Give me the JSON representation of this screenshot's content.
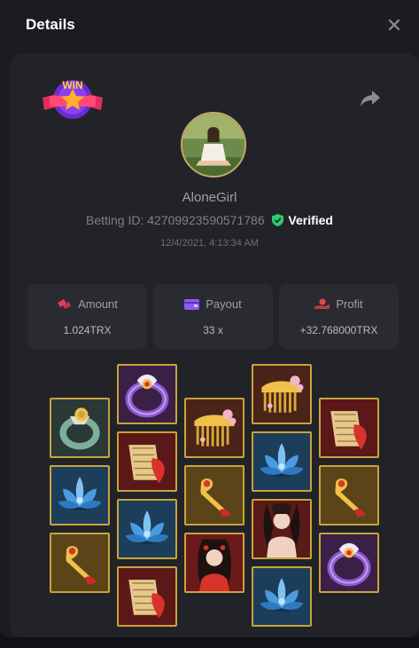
{
  "header": {
    "title": "Details",
    "close_icon": "close-icon"
  },
  "badge": {
    "text": "WIN",
    "icon": "win-star-badge"
  },
  "share": {
    "icon": "share-icon"
  },
  "user": {
    "name": "AloneGirl",
    "betting_id_label": "Betting ID:",
    "betting_id": "427099235905717​86",
    "verified_label": "Verified",
    "timestamp": "12/4/2021, 4:13:34 AM"
  },
  "stats": [
    {
      "label": "Amount",
      "value": "1.024TRX",
      "icon": "chips-icon",
      "color": "#e0405a"
    },
    {
      "label": "Payout",
      "value": "33 x",
      "icon": "wallet-icon",
      "color": "#8a5cf5"
    },
    {
      "label": "Profit",
      "value": "+32.768000TRX",
      "icon": "profit-hand-icon",
      "color": "#e04848"
    }
  ],
  "colors": {
    "accent_gold": "#c9a33c",
    "verified_green": "#2ecc71",
    "panel": "#222328"
  },
  "reels": [
    [
      "jade-ring",
      "blue-lotus",
      "gold-hairpin"
    ],
    [
      "purple-ring",
      "guzheng",
      "blue-lotus",
      "guzheng"
    ],
    [
      "gold-comb",
      "gold-hairpin",
      "red-lady"
    ],
    [
      "gold-comb",
      "blue-lotus",
      "pale-lady",
      "blue-lotus"
    ],
    [
      "guzheng",
      "gold-hairpin",
      "purple-ring"
    ]
  ]
}
